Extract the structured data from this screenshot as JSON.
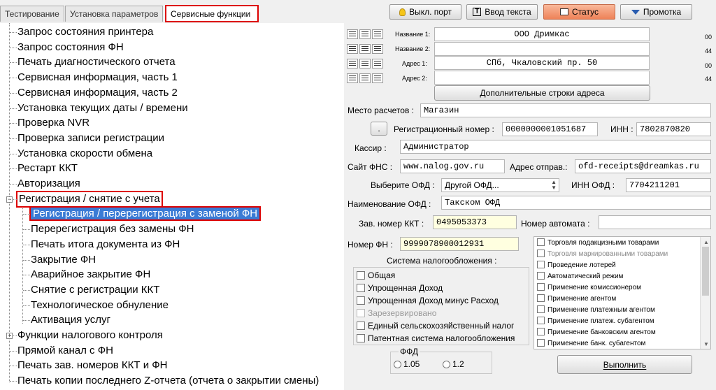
{
  "tabs": [
    "Тестирование",
    "Установка параметров",
    "Сервисные функции"
  ],
  "toolbar": {
    "port": "Выкл. порт",
    "text_input": "Ввод текста",
    "status": "Статус",
    "scroll": "Промотка"
  },
  "tree": {
    "items": [
      "Запрос состояния принтера",
      "Запрос состояния ФН",
      "Печать диагностического отчета",
      "Сервисная информация, часть 1",
      "Сервисная информация, часть 2",
      "Установка текущих даты / времени",
      "Проверка NVR",
      "Проверка записи регистрации",
      "Установка скорости обмена",
      "Рестарт ККТ",
      "Авторизация"
    ],
    "group": "Регистрация / снятие с учета",
    "children": [
      "Регистрация / перерегистрация с заменой ФН",
      "Перерегистрация без замены ФН",
      "Печать итога документа из ФН",
      "Закрытие ФН",
      "Аварийное закрытие ФН",
      "Снятие с регистрации ККТ",
      "Технологическое обнуление",
      "Активация услуг"
    ],
    "after": [
      "Функции налогового контроля",
      "Прямой канал с ФН",
      "Печать зав. номеров ККТ и ФН",
      "Печать копии последнего Z-отчета (отчета о закрытии смены)"
    ]
  },
  "header_lines": {
    "name1_label": "Название 1:",
    "name1": "ООО Дримкас",
    "name1_num": "00",
    "name2_label": "Название 2:",
    "name2": "",
    "name2_num": "44",
    "addr1_label": "Адрес 1:",
    "addr1": "СПб, Чкаловский пр. 50",
    "addr1_num": "00",
    "addr2_label": "Адрес 2:",
    "addr2": "",
    "addr2_num": "44",
    "extra_button": "Дополнительные строки адреса"
  },
  "form": {
    "place_label": "Место расчетов :",
    "place": "Магазин",
    "dot_button": ".",
    "regnum_label": "Регистрационный номер :",
    "regnum": "0000000001051687",
    "inn_label": "ИНН :",
    "inn": "7802870820",
    "cashier_label": "Кассир :",
    "cashier": "Администратор",
    "fns_label": "Сайт ФНС :",
    "fns": "www.nalog.gov.ru",
    "sender_label": "Адрес отправ.:",
    "sender": "ofd-receipts@dreamkas.ru",
    "ofd_select_label": "Выберите ОФД :",
    "ofd_select": "Другой ОФД...",
    "ofd_inn_label": "ИНН ОФД :",
    "ofd_inn": "7704211201",
    "ofd_name_label": "Наименование ОФД :",
    "ofd_name": "Такском ОФД",
    "kkt_serial_label": "Зав. номер ККТ :",
    "kkt_serial": "0495053373",
    "auto_num_label": "Номер автомата :",
    "auto_num": "",
    "fn_num_label": "Номер ФН :",
    "fn_num": "9999078900012931"
  },
  "tax": {
    "title": "Система налогообложения :",
    "options": [
      {
        "label": "Общая",
        "disabled": false
      },
      {
        "label": "Упрощенная Доход",
        "disabled": false
      },
      {
        "label": "Упрощенная Доход минус Расход",
        "disabled": false
      },
      {
        "label": "Зарезервировано",
        "disabled": true
      },
      {
        "label": "Единый сельскохозяйственный налог",
        "disabled": false
      },
      {
        "label": "Патентная система налогообложения",
        "disabled": false
      }
    ]
  },
  "features": [
    {
      "label": "Торговля подакцизными товарами",
      "disabled": false
    },
    {
      "label": "Торговля маркированными товарами",
      "disabled": true
    },
    {
      "label": "Проведение лотерей",
      "disabled": false
    },
    {
      "label": "Автоматический режим",
      "disabled": false
    },
    {
      "label": "Применение комиссионером",
      "disabled": false
    },
    {
      "label": "Применение агентом",
      "disabled": false
    },
    {
      "label": "Применение платежным агентом",
      "disabled": false
    },
    {
      "label": "Применение платеж. субагентом",
      "disabled": false
    },
    {
      "label": "Применение банковским агентом",
      "disabled": false
    },
    {
      "label": "Применение банк. субагентом",
      "disabled": false
    }
  ],
  "ffd": {
    "title": "ФФД",
    "opt1": "1.05",
    "opt2": "1.2"
  },
  "execute": "Выполнить",
  "colors": {
    "highlight_red": "#d00000",
    "selection_blue": "#3a7bd5",
    "status_orange": "#ee8258"
  }
}
